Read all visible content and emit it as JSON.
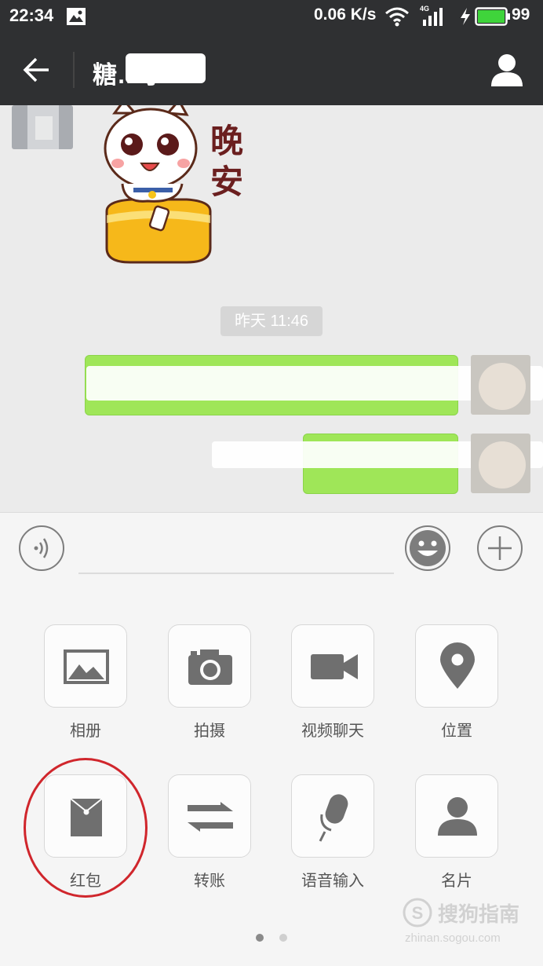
{
  "status_bar": {
    "time": "22:34",
    "speed": "0.06 K/s",
    "network": "4G",
    "battery": "99"
  },
  "header": {
    "title": "糖…子"
  },
  "chat": {
    "sticker_text_line1": "晚",
    "sticker_text_line2": "安",
    "timestamp": "昨天 11:46"
  },
  "panel": {
    "items": [
      {
        "label": "相册",
        "icon": "photo-album-icon"
      },
      {
        "label": "拍摄",
        "icon": "camera-icon"
      },
      {
        "label": "视频聊天",
        "icon": "video-call-icon"
      },
      {
        "label": "位置",
        "icon": "location-pin-icon"
      },
      {
        "label": "红包",
        "icon": "red-packet-icon"
      },
      {
        "label": "转账",
        "icon": "transfer-icon"
      },
      {
        "label": "语音输入",
        "icon": "microphone-icon"
      },
      {
        "label": "名片",
        "icon": "contact-card-icon"
      }
    ],
    "page_indicator": {
      "current": 1,
      "total": 2
    }
  },
  "watermark": {
    "brand": "搜狗指南",
    "url": "zhinan.sogou.com"
  },
  "colors": {
    "bar_bg": "#2f3032",
    "bubble_green": "#9fe658",
    "battery_green": "#3fd43b",
    "highlight_red": "#d0262c"
  }
}
